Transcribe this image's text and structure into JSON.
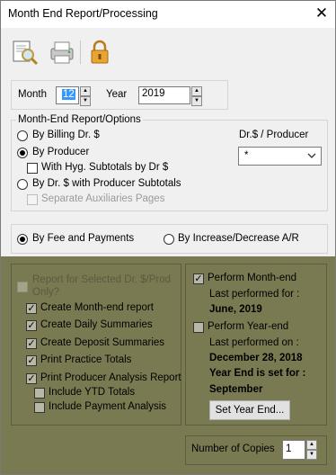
{
  "window": {
    "title": "Month End Report/Processing",
    "close_glyph": "✕"
  },
  "toolbar": {
    "icons": [
      "preview-icon",
      "printer-icon",
      "lock-icon"
    ]
  },
  "period": {
    "month_label": "Month",
    "month_value": "12",
    "year_label": "Year",
    "year_value": "2019"
  },
  "report_options": {
    "legend": "Month-End Report/Options",
    "by_billing": "By Billing Dr. $",
    "by_producer": "By Producer",
    "with_hyg_subtotals": "With Hyg. Subtotals by Dr $",
    "by_dr_producer_subtotals": "By Dr. $ with Producer Subtotals",
    "separate_aux_pages": "Separate Auxiliaries Pages",
    "dr_producer_label": "Dr.$ / Producer",
    "dr_producer_value": "*"
  },
  "mode": {
    "by_fee_payments": "By Fee and Payments",
    "by_increase_decrease": "By Increase/Decrease A/R"
  },
  "left_panel": {
    "report_selected_line1": "Report for Selected Dr. $/Prod",
    "report_selected_line2": "Only?",
    "create_month_end": "Create Month-end report",
    "create_daily": "Create Daily Summaries",
    "create_deposit": "Create Deposit Summaries",
    "print_practice": "Print Practice Totals",
    "print_producer": "Print Producer Analysis Report",
    "include_ytd": "Include YTD Totals",
    "include_payment": "Include Payment Analysis"
  },
  "right_panel": {
    "perform_month_end": "Perform Month-end",
    "last_performed_for": "Last performed for :",
    "month_end_date": "June, 2019",
    "perform_year_end": "Perform Year-end",
    "last_performed_on": "Last performed on :",
    "year_end_date": "December 28, 2018",
    "year_end_set_line1": "Year End is set for :",
    "year_end_set_line2": "September",
    "set_year_end_button": "Set Year End..."
  },
  "copies": {
    "label": "Number of Copies",
    "value": "1"
  },
  "colors": {
    "olive_overlay": "#7a7a52",
    "selection": "#3399ff"
  }
}
